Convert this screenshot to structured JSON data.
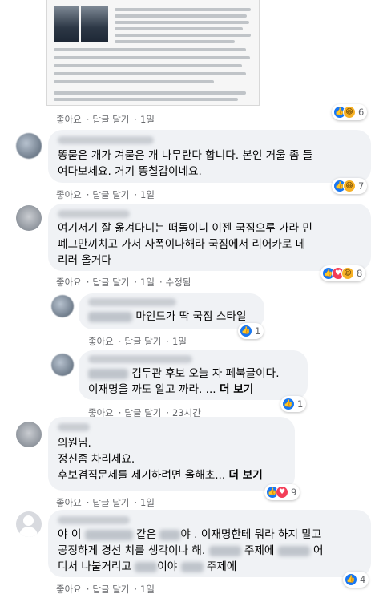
{
  "common": {
    "like": "좋아요",
    "reply": "답글 달기",
    "dot": "·",
    "time_1d": "1일",
    "time_23h": "23시간",
    "edited": "수정됨",
    "see_more": "더 보기"
  },
  "comments": [
    {
      "lines": [],
      "reactions": [
        "like",
        "haha"
      ],
      "count": "6"
    },
    {
      "lines": [
        "똥묻은 개가 겨묻은 개 나무란다 합니다. 본인 거울 좀 들",
        "여다보세요. 거기 똥칠갑이네요."
      ],
      "reactions": [
        "like",
        "haha"
      ],
      "count": "7"
    },
    {
      "lines": [
        "여기저기 잘 옮겨다니는 떠돌이니 이젠 국짐으루 가라 민",
        "폐그만끼치고 가서 자폭이나해라 국짐에서 리어카로 데",
        "리러 올거다"
      ],
      "reactions": [
        "like",
        "love",
        "haha"
      ],
      "count": "8"
    },
    {
      "text": "마인드가 딱 국짐 스타일",
      "reactions": [
        "like"
      ],
      "count": "1"
    },
    {
      "line1": "김두관 후보 오늘 자 페북글이다.",
      "line2": "이재명을 까도 알고 까라. ...",
      "reactions": [
        "like"
      ],
      "count": "1"
    },
    {
      "lines": [
        "의원님.",
        "정신좀 차리세요.",
        "후보겸직문제를 제기하려면 올해초..."
      ],
      "reactions": [
        "like",
        "love"
      ],
      "count": "9"
    },
    {
      "line1a": "야 이",
      "line1b": "같은",
      "line1c": "야 . 이재명한테 뭐라 하지 말고",
      "line2a": "공정하게 경선 치를 생각이나 해.",
      "line2b": "주제에",
      "line2c": "어",
      "line3a": "디서 나불거리고",
      "line3b": "이야",
      "line3c": "주제에",
      "reactions": [
        "like"
      ],
      "count": "4"
    }
  ]
}
